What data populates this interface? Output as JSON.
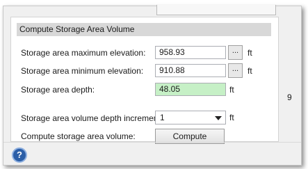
{
  "group": {
    "title": "Compute Storage Area Volume"
  },
  "rows": {
    "max_elev": {
      "label": "Storage area maximum elevation:",
      "value": "958.93",
      "browse": "...",
      "unit": "ft"
    },
    "min_elev": {
      "label": "Storage area minimum elevation:",
      "value": "910.88",
      "browse": "...",
      "unit": "ft"
    },
    "depth": {
      "label": "Storage area depth:",
      "value": "48.05",
      "unit": "ft"
    },
    "increment": {
      "label": "Storage area volume depth increment:",
      "value": "1",
      "unit": "ft"
    },
    "compute": {
      "label": "Compute storage area volume:",
      "button": "Compute"
    }
  },
  "right_fragment": "9",
  "help": {
    "icon": "help-icon",
    "glyph": "?"
  },
  "colors": {
    "depth_field": "#c6f0c6",
    "header_bg": "#d8d8d8",
    "help": "#2b5ea7"
  }
}
